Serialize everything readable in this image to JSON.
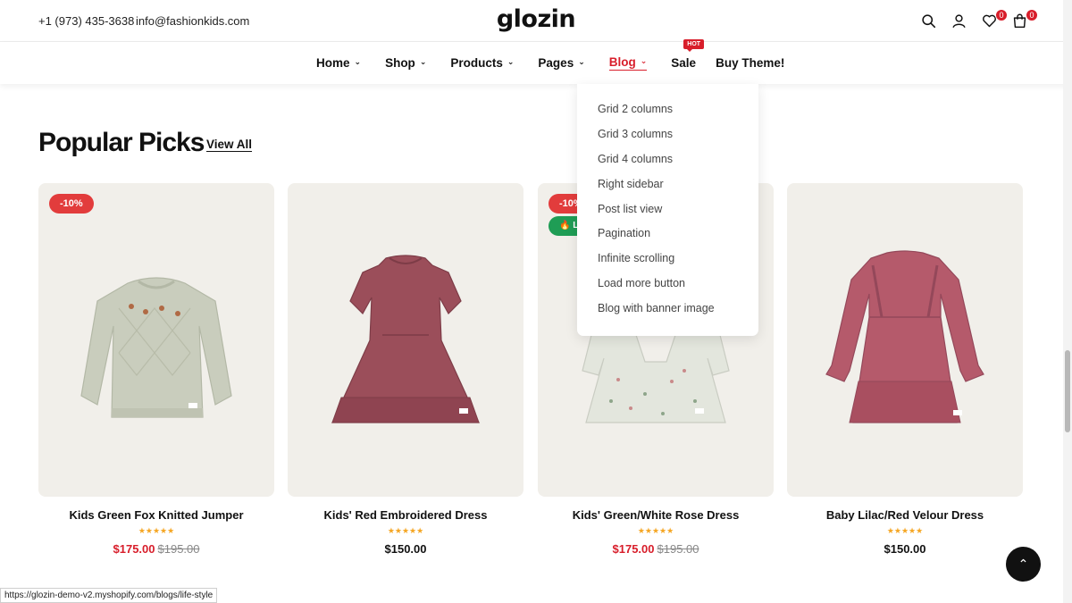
{
  "topbar": {
    "phone": "+1 (973) 435-3638",
    "email": "info@fashionkids.com",
    "logo": "glozin",
    "wishlist_count": "0",
    "cart_count": "0",
    "icons": [
      "search-icon",
      "user-icon",
      "heart-icon",
      "cart-icon"
    ]
  },
  "nav": {
    "items": [
      {
        "label": "Home",
        "has_dropdown": true
      },
      {
        "label": "Shop",
        "has_dropdown": true
      },
      {
        "label": "Products",
        "has_dropdown": true
      },
      {
        "label": "Pages",
        "has_dropdown": true
      },
      {
        "label": "Blog",
        "has_dropdown": true,
        "active": true
      },
      {
        "label": "Sale",
        "badge": "HOT"
      },
      {
        "label": "Buy Theme!"
      }
    ]
  },
  "blog_menu": [
    "Grid 2 columns",
    "Grid 3 columns",
    "Grid 4 columns",
    "Right sidebar",
    "Post list view",
    "Pagination",
    "Infinite scrolling",
    "Load more button",
    "Blog with banner image"
  ],
  "section": {
    "title": "Popular Picks",
    "view_all": "View All"
  },
  "products": [
    {
      "name": "Kids Green Fox Knitted Jumper",
      "price": "$175.00",
      "old_price": "$195.00",
      "discount": "-10%",
      "rating": 5
    },
    {
      "name": "Kids' Red Embroidered Dress",
      "price": "$150.00",
      "rating": 5
    },
    {
      "name": "Kids' Green/White Rose Dress",
      "price": "$175.00",
      "old_price": "$195.00",
      "discount": "-10%",
      "live_badge": "Li",
      "rating": 5
    },
    {
      "name": "Baby Lilac/Red Velour Dress",
      "price": "$150.00",
      "rating": 5
    }
  ],
  "status_bar": {
    "url": "https://glozin-demo-v2.myshopify.com/blogs/life-style"
  },
  "colors": {
    "accent": "#d81e2b",
    "discount_badge": "#e23c3c",
    "live_badge": "#1f9d55",
    "card_bg": "#f1efea",
    "stars": "#f5a623"
  }
}
